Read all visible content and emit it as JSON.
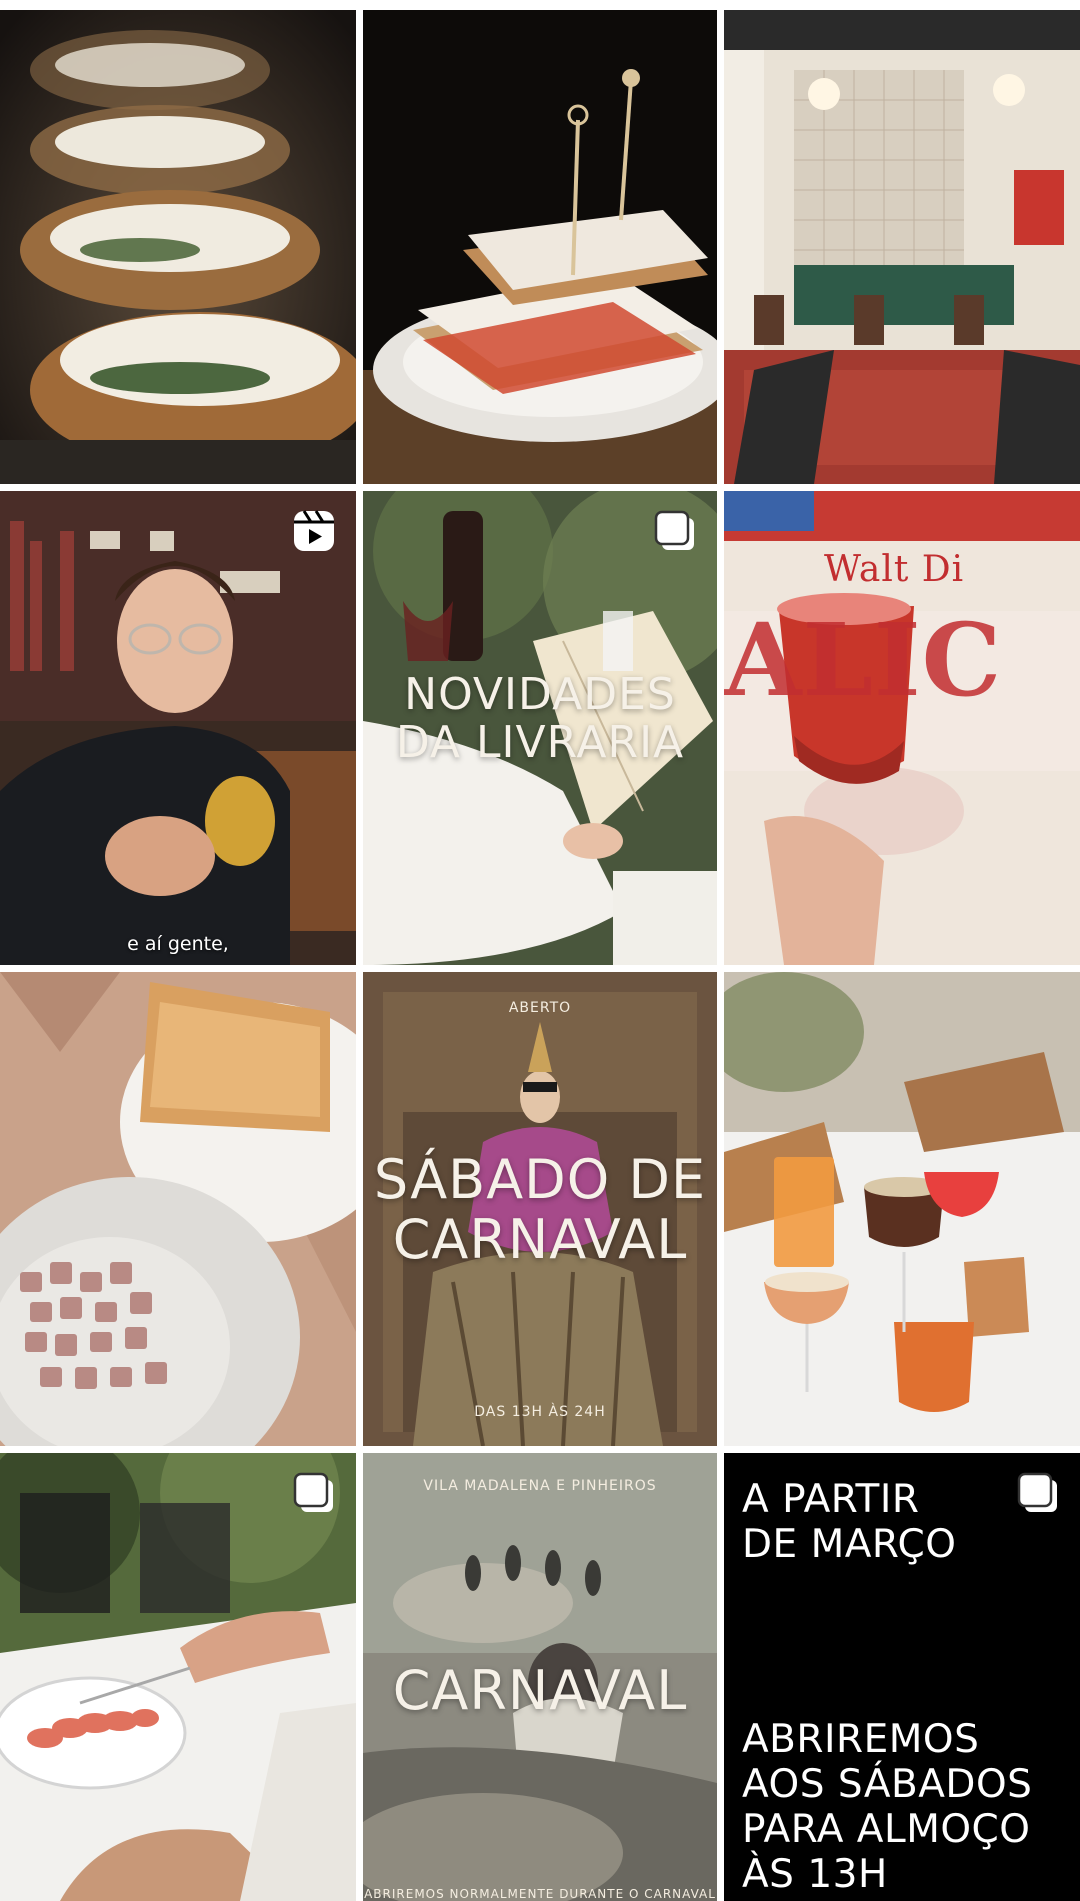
{
  "grid": {
    "tiles": [
      {
        "id": "sandwich-cheese",
        "type": "photo",
        "alt": "",
        "badge": "none"
      },
      {
        "id": "club-sandwich",
        "type": "photo",
        "alt": "",
        "badge": "none"
      },
      {
        "id": "restaurant-interior",
        "type": "photo",
        "alt": "",
        "badge": "none"
      },
      {
        "id": "man-video",
        "type": "reel",
        "badge": "reel-icon",
        "caption": "e aí gente,"
      },
      {
        "id": "bookstore",
        "type": "carousel",
        "badge": "carousel-icon",
        "title_line1": "NOVIDADES",
        "title_line2": "DA LIVRARIA"
      },
      {
        "id": "red-drink",
        "type": "photo",
        "badge": "none",
        "poster_text_1": "Walt Di",
        "poster_text_2": "ALIC"
      },
      {
        "id": "tartare",
        "type": "photo",
        "badge": "none"
      },
      {
        "id": "carnaval-saturday",
        "type": "photo",
        "badge": "none",
        "kicker": "ABERTO",
        "title_line1": "SÁBADO DE",
        "title_line2": "CARNAVAL",
        "footer": "DAS 13H ÀS 24H"
      },
      {
        "id": "cocktails",
        "type": "photo",
        "badge": "none"
      },
      {
        "id": "sashimi-plate",
        "type": "carousel",
        "badge": "carousel-icon"
      },
      {
        "id": "carnaval-ballet",
        "type": "photo",
        "badge": "none",
        "kicker": "VILA MADALENA E PINHEIROS",
        "title": "CARNAVAL",
        "footer": "ABRIREMOS NORMALMENTE DURANTE O CARNAVAL"
      },
      {
        "id": "march-notice",
        "type": "carousel",
        "badge": "carousel-icon",
        "text_top": "A PARTIR\nDE MARÇO",
        "text_bottom": "ABRIREMOS\nAOS SÁBADOS\nPARA ALMOÇO\nÀS 13H"
      }
    ]
  },
  "colors": {
    "background": "#ffffff",
    "black_tile": "#000000",
    "overlay_text": "#f6f1e8",
    "badge": "#ffffff"
  }
}
